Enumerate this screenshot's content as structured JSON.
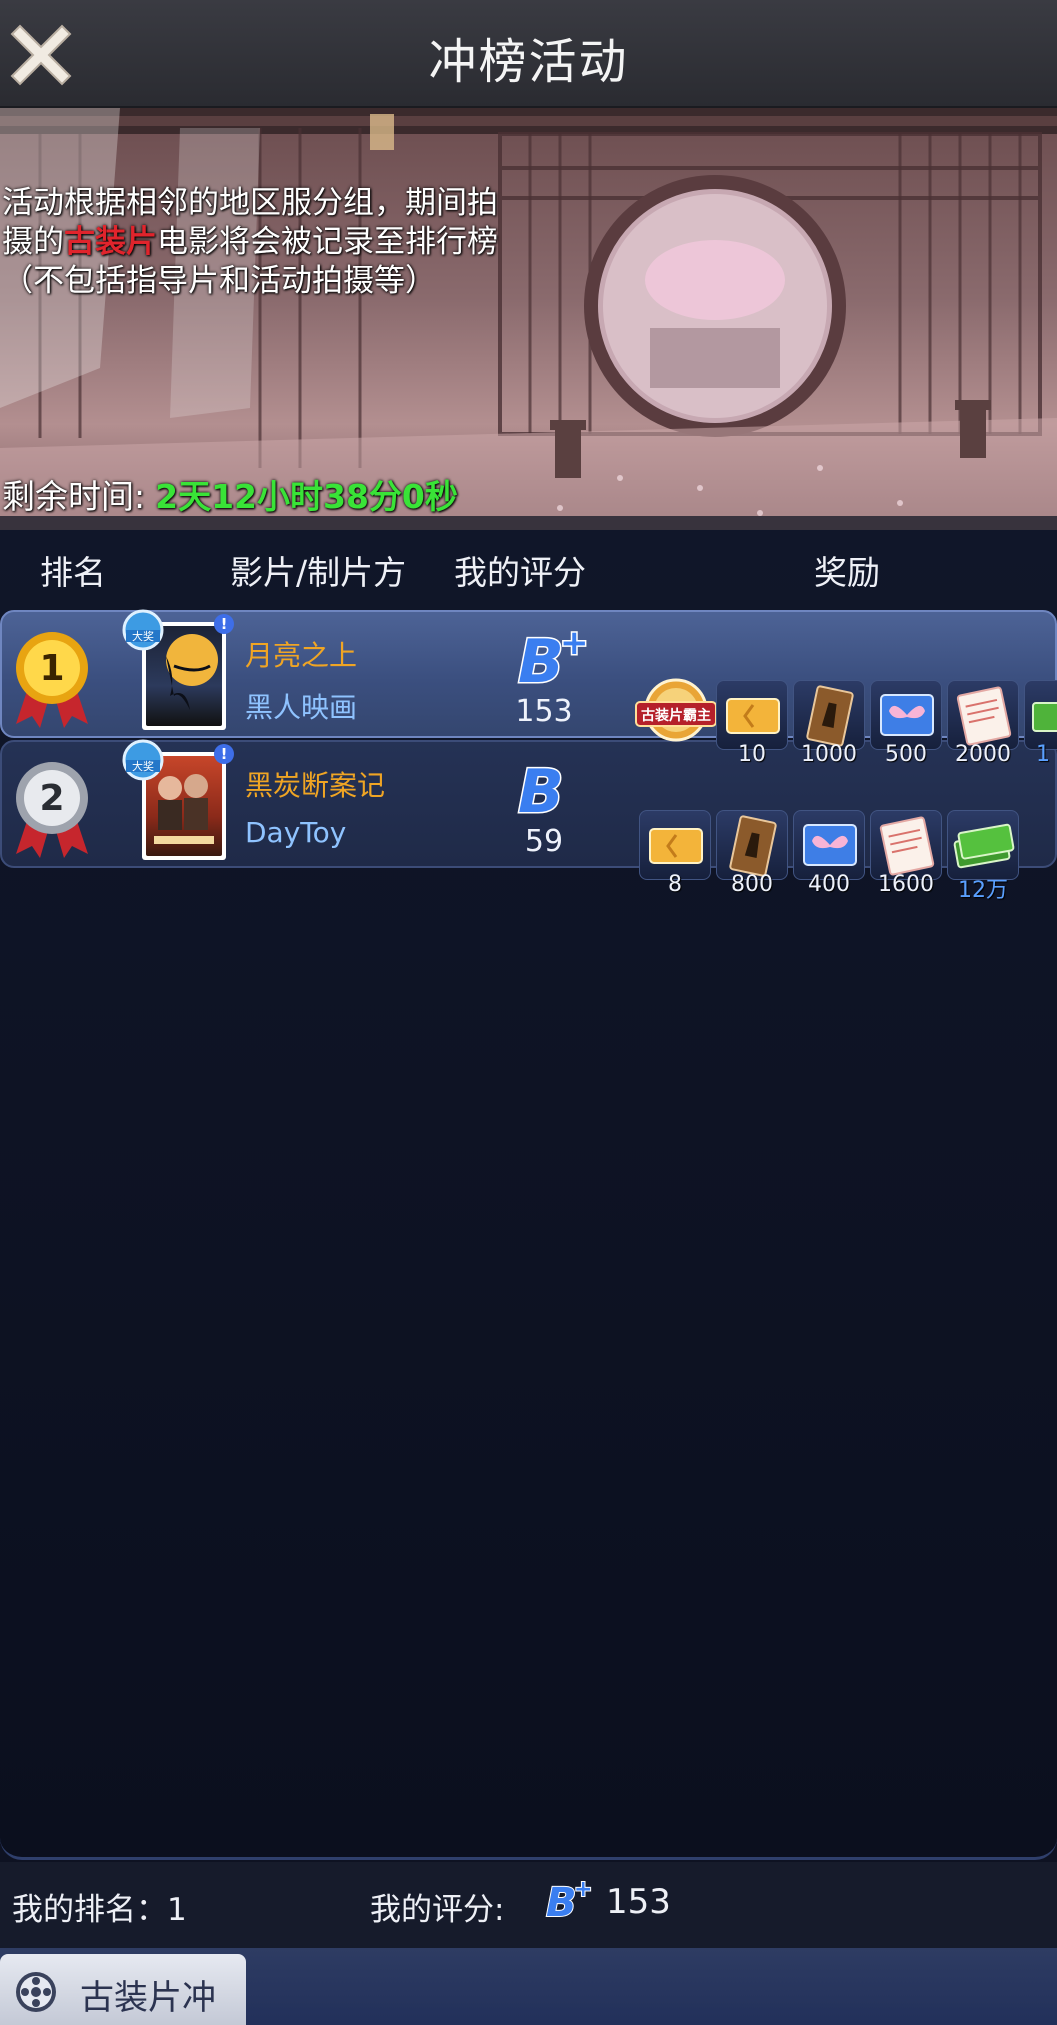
{
  "header": {
    "title": "冲榜活动"
  },
  "banner": {
    "desc_part1": "活动根据相邻的地区服分组，期间拍摄的",
    "desc_highlight": "古装片",
    "desc_part2": "电影将会被记录至排行榜（不包括指导片和活动拍摄等）",
    "remaining_label": "剩余时间:",
    "remaining_value": "2天12小时38分0秒"
  },
  "table": {
    "columns": {
      "rank": "排名",
      "film": "影片/制片方",
      "score": "我的评分",
      "reward": "奖励"
    },
    "rows": [
      {
        "rank": "1",
        "film": "月亮之上",
        "producer": "黑人映画",
        "grade": "B+",
        "score": "153",
        "title_badge": "古装片霸主",
        "rewards": [
          {
            "icon": "ticket-icon",
            "qty": "10"
          },
          {
            "icon": "script-book-icon",
            "qty": "1000"
          },
          {
            "icon": "butterfly-book-icon",
            "qty": "500"
          },
          {
            "icon": "contract-paper-icon",
            "qty": "2000"
          },
          {
            "icon": "cash-icon",
            "qty": "1"
          }
        ]
      },
      {
        "rank": "2",
        "film": "黑炭断案记",
        "producer": "DayToy",
        "grade": "B",
        "score": "59",
        "rewards": [
          {
            "icon": "ticket-icon",
            "qty": "8"
          },
          {
            "icon": "script-book-icon",
            "qty": "800"
          },
          {
            "icon": "butterfly-book-icon",
            "qty": "400"
          },
          {
            "icon": "contract-paper-icon",
            "qty": "1600"
          },
          {
            "icon": "cash-icon",
            "qty": "12万"
          }
        ]
      }
    ]
  },
  "footer": {
    "my_rank": "我的排名：1",
    "my_score_label": "我的评分:",
    "my_score_grade": "B+",
    "my_score_value": "153",
    "tab_label": "古装片冲"
  },
  "colors": {
    "highlight_red": "#e0242c",
    "timer_green": "#39e337",
    "film_title_orange": "#f0a524",
    "producer_blue": "#8fc3ff",
    "grade_blue": "#3a7ef0"
  }
}
